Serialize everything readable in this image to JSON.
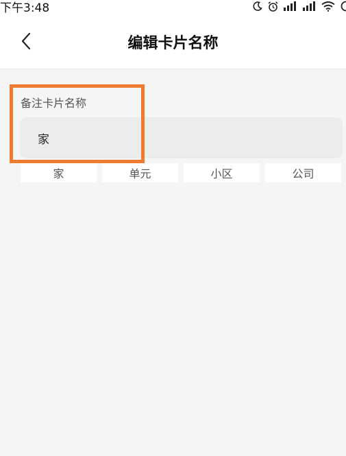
{
  "status_bar": {
    "time": "下午3:48",
    "icons": [
      "moon-icon",
      "alarm-icon",
      "signal-icon",
      "signal-icon",
      "wifi-icon",
      "battery-icon"
    ]
  },
  "header": {
    "title": "编辑卡片名称",
    "back_icon": "chevron-left-icon"
  },
  "form": {
    "label": "备注卡片名称",
    "value": "家"
  },
  "suggestions": [
    {
      "label": "家"
    },
    {
      "label": "单元"
    },
    {
      "label": "小区"
    },
    {
      "label": "公司"
    }
  ],
  "colors": {
    "highlight": "#ee7b30",
    "background": "#f5f5f5",
    "input_background": "#ececec"
  }
}
